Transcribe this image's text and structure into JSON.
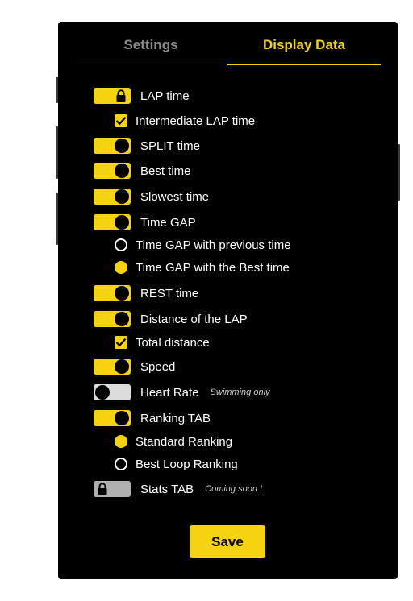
{
  "tabs": {
    "settings": "Settings",
    "display": "Display Data"
  },
  "items": {
    "lap_time": "LAP time",
    "intermediate_lap": "Intermediate LAP time",
    "split_time": "SPLIT time",
    "best_time": "Best time",
    "slowest_time": "Slowest time",
    "time_gap": "Time GAP",
    "gap_previous": "Time GAP with previous time",
    "gap_best": "Time GAP with the Best time",
    "rest_time": "REST time",
    "distance_lap": "Distance of the LAP",
    "total_distance": "Total distance",
    "speed": "Speed",
    "heart_rate": "Heart Rate",
    "heart_rate_note": "Swimming only",
    "ranking_tab": "Ranking TAB",
    "standard_ranking": "Standard Ranking",
    "best_loop_ranking": "Best Loop Ranking",
    "stats_tab": "Stats TAB",
    "stats_note": "Coming soon !"
  },
  "save_label": "Save",
  "colors": {
    "accent": "#f5d311",
    "background": "#000000",
    "inactive": "#8a8a8a",
    "toggle_off": "#dcdcdc"
  },
  "icons": {
    "lock": "lock-icon",
    "check": "check-icon"
  }
}
